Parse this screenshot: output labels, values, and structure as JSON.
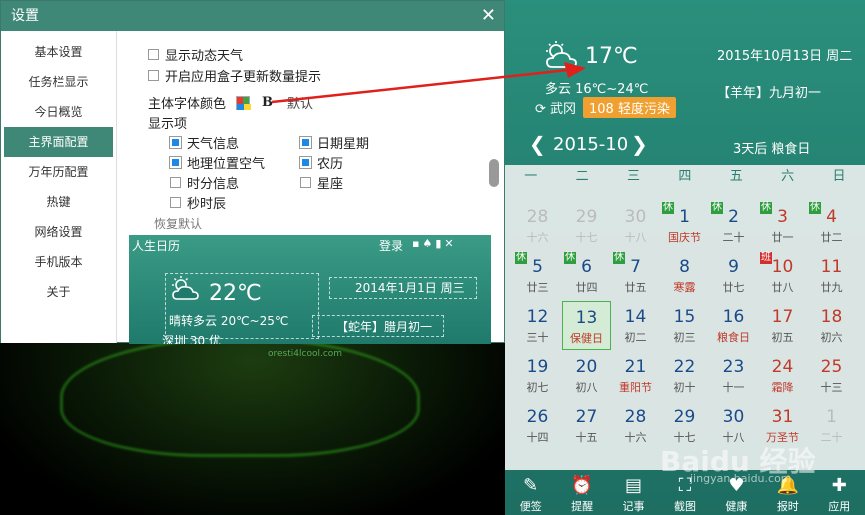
{
  "settings": {
    "title": "设置",
    "nav": [
      "基本设置",
      "任务栏显示",
      "今日概览",
      "主界面配置",
      "万年历配置",
      "热键",
      "网络设置",
      "手机版本",
      "关于"
    ],
    "active_index": 3,
    "options": {
      "dynamic_weather": "显示动态天气",
      "box_update": "开启应用盒子更新数量提示",
      "font_color_label": "主体字体颜色",
      "bold_label": "B",
      "default_label": "默认",
      "display_items_label": "显示项",
      "weather_info": "天气信息",
      "date_week": "日期星期",
      "location_air": "地理位置空气",
      "lunar": "农历",
      "hm_info": "时分信息",
      "zodiac": "星座",
      "seconds": "秒时辰",
      "restore_default": "恢复默认"
    },
    "preview": {
      "title": "人生日历",
      "login": "登录",
      "temp": "22℃",
      "weather": "晴转多云 20℃~25℃",
      "date": "2014年1月1日 周三",
      "lunar": "【蛇年】腊月初一",
      "city": "深圳 30 优"
    }
  },
  "background": {
    "url_text": "oresti4lcool.com"
  },
  "calendar": {
    "temp": "17℃",
    "weather": "多云 16℃~24℃",
    "city": "武冈",
    "aqi": "108 轻度污染",
    "date": "2015年10月13日 周二",
    "lunar": "【羊年】九月初一",
    "month": "2015-10",
    "countdown": "3天后 粮食日",
    "weekdays": [
      "一",
      "二",
      "三",
      "四",
      "五",
      "六",
      "日"
    ],
    "days": [
      {
        "n": "28",
        "s": "十六",
        "other": true
      },
      {
        "n": "29",
        "s": "十七",
        "other": true
      },
      {
        "n": "30",
        "s": "十八",
        "other": true
      },
      {
        "n": "1",
        "s": "国庆节",
        "badge": "休",
        "sred": true
      },
      {
        "n": "2",
        "s": "二十",
        "badge": "休"
      },
      {
        "n": "3",
        "s": "廿一",
        "badge": "休",
        "red": true
      },
      {
        "n": "4",
        "s": "廿二",
        "badge": "休",
        "red": true
      },
      {
        "n": "5",
        "s": "廿三",
        "badge": "休"
      },
      {
        "n": "6",
        "s": "廿四",
        "badge": "休"
      },
      {
        "n": "7",
        "s": "廿五",
        "badge": "休"
      },
      {
        "n": "8",
        "s": "寒露",
        "sred": true
      },
      {
        "n": "9",
        "s": "廿七"
      },
      {
        "n": "10",
        "s": "廿八",
        "badge": "班",
        "ban": true,
        "red": true
      },
      {
        "n": "11",
        "s": "廿九",
        "red": true
      },
      {
        "n": "12",
        "s": "三十"
      },
      {
        "n": "13",
        "s": "保健日",
        "today": true,
        "sred": true
      },
      {
        "n": "14",
        "s": "初二"
      },
      {
        "n": "15",
        "s": "初三"
      },
      {
        "n": "16",
        "s": "粮食日",
        "sred": true
      },
      {
        "n": "17",
        "s": "初五",
        "red": true
      },
      {
        "n": "18",
        "s": "初六",
        "red": true
      },
      {
        "n": "19",
        "s": "初七"
      },
      {
        "n": "20",
        "s": "初八"
      },
      {
        "n": "21",
        "s": "重阳节",
        "sred": true
      },
      {
        "n": "22",
        "s": "初十"
      },
      {
        "n": "23",
        "s": "十一"
      },
      {
        "n": "24",
        "s": "霜降",
        "red": true,
        "sred": true
      },
      {
        "n": "25",
        "s": "十三",
        "red": true
      },
      {
        "n": "26",
        "s": "十四"
      },
      {
        "n": "27",
        "s": "十五"
      },
      {
        "n": "28",
        "s": "十六"
      },
      {
        "n": "29",
        "s": "十七"
      },
      {
        "n": "30",
        "s": "十八"
      },
      {
        "n": "31",
        "s": "万圣节",
        "red": true,
        "sred": true
      },
      {
        "n": "1",
        "s": "二十",
        "other": true
      }
    ],
    "dock": [
      {
        "label": "便签",
        "icon": "✎"
      },
      {
        "label": "提醒",
        "icon": "⏰"
      },
      {
        "label": "记事",
        "icon": "▤"
      },
      {
        "label": "截图",
        "icon": "⛶"
      },
      {
        "label": "健康",
        "icon": "♥"
      },
      {
        "label": "报时",
        "icon": "🔔"
      },
      {
        "label": "应用",
        "icon": "✚"
      }
    ]
  },
  "watermark": {
    "text": "Baidu 经验",
    "sub": "jingyan.baidu.com"
  }
}
